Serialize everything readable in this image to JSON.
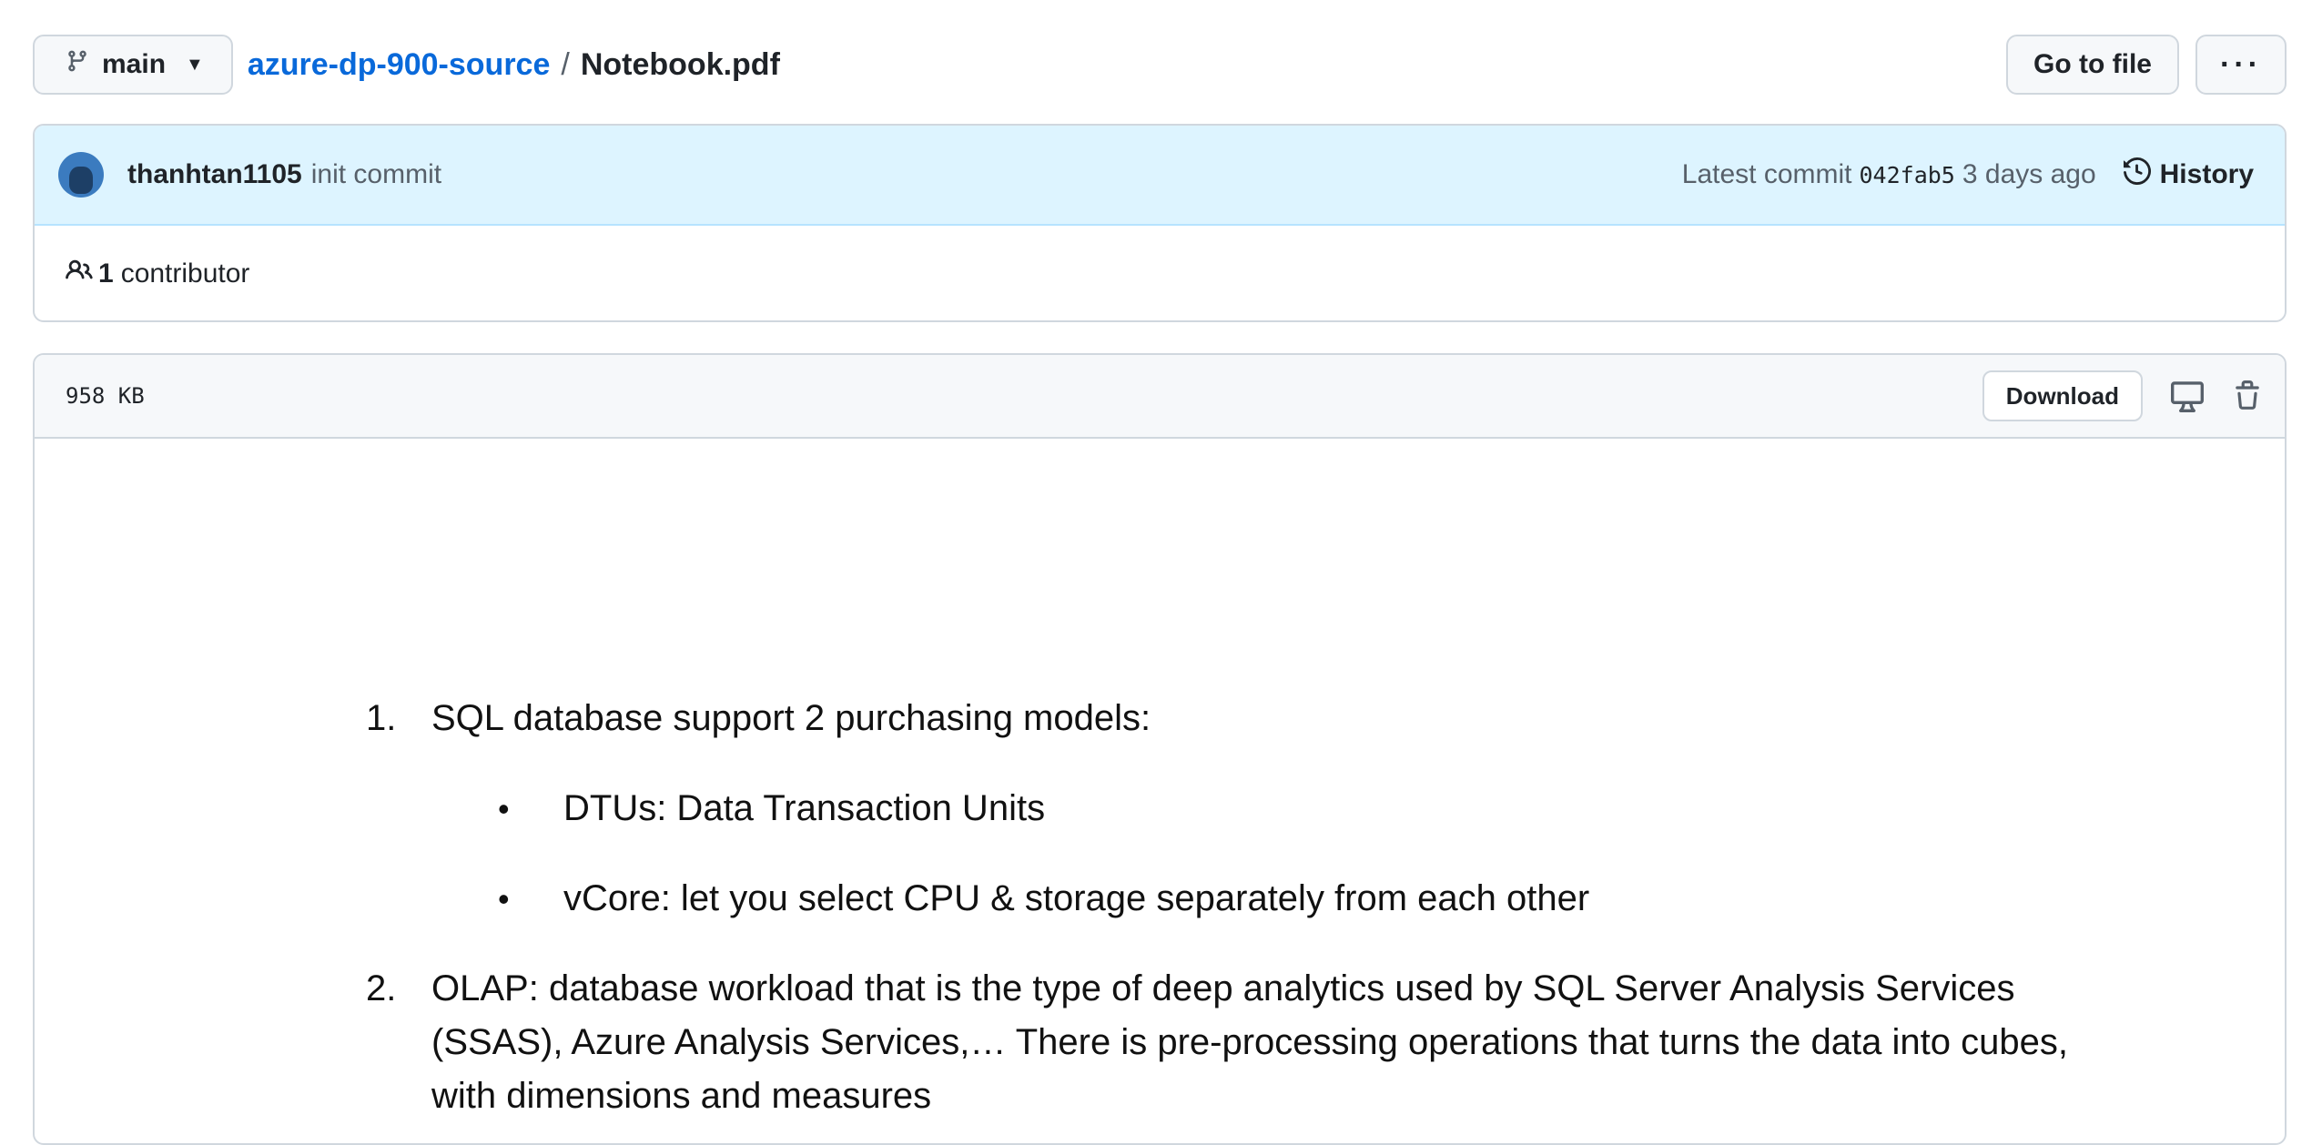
{
  "branch": {
    "name": "main"
  },
  "breadcrumb": {
    "repo": "azure-dp-900-source",
    "separator": "/",
    "file": "Notebook.pdf"
  },
  "toolbar": {
    "go_to_file": "Go to file",
    "more": "···"
  },
  "commit": {
    "author": "thanhtan1105",
    "message": "init commit",
    "latest_label": "Latest commit",
    "sha": "042fab5",
    "age": "3 days ago",
    "history_label": "History"
  },
  "contributors": {
    "count": "1",
    "label": "contributor"
  },
  "file": {
    "size": "958 KB",
    "download_label": "Download"
  },
  "document": {
    "item1_num": "1.",
    "item1_text": "SQL database support 2 purchasing models:",
    "bullet_char": "•",
    "bullet1": "DTUs: Data Transaction Units",
    "bullet2": "vCore: let you select CPU & storage separately from each other",
    "item2_num": "2.",
    "item2_text": "OLAP: database workload that is the type of deep analytics used by SQL Server Analysis Services (SSAS), Azure Analysis Services,… There is pre-processing operations that turns the data into cubes, with dimensions and measures"
  },
  "icons": [
    "git-branch-icon",
    "caret-down-icon",
    "history-icon",
    "people-icon",
    "desktop-icon",
    "trash-icon"
  ],
  "colors": {
    "link": "#0969da",
    "commit_bg": "#ddf4ff",
    "border": "#d0d7de",
    "header_bg": "#f6f8fa"
  }
}
